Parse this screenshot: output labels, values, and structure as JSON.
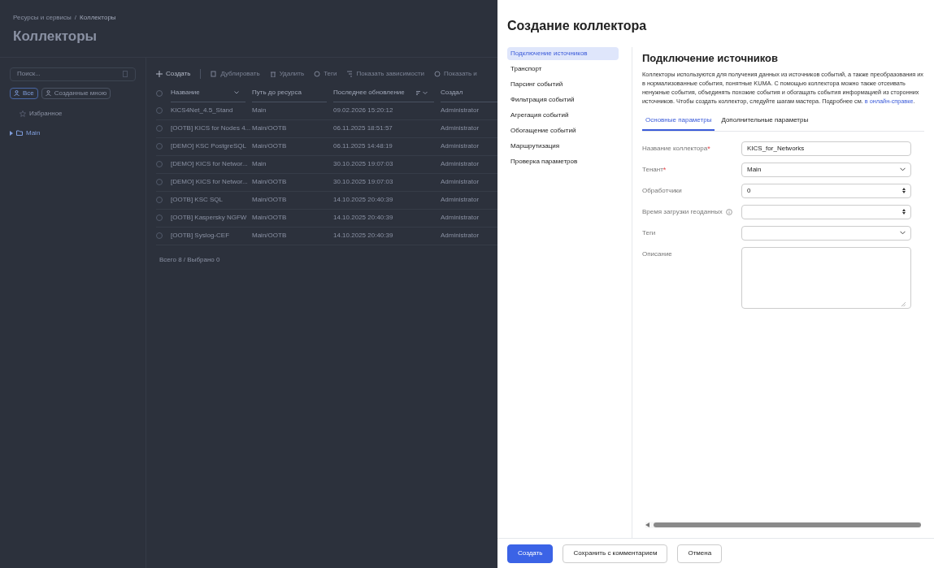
{
  "breadcrumb": {
    "items": [
      "Ресурсы и сервисы",
      "Коллекторы"
    ],
    "separator": "/"
  },
  "page_title": "Коллекторы",
  "sidebar": {
    "search": {
      "placeholder": "Поиск..."
    },
    "filters": [
      {
        "label": "Все",
        "selected": true
      },
      {
        "label": "Созданные мною",
        "selected": false
      }
    ],
    "tree": [
      {
        "label": "Избранное",
        "kind": "favorites"
      },
      {
        "label": "Main",
        "kind": "folder",
        "expanded": false
      }
    ]
  },
  "toolbar": [
    {
      "label": "Создать",
      "kind": "create",
      "disabled": false
    },
    {
      "label": "Дублировать",
      "kind": "duplicate",
      "disabled": true
    },
    {
      "label": "Удалить",
      "kind": "delete",
      "disabled": true
    },
    {
      "label": "Теги",
      "kind": "tags",
      "disabled": true
    },
    {
      "label": "Показать зависимости",
      "kind": "deps",
      "disabled": true
    },
    {
      "label": "Показать и",
      "kind": "history",
      "disabled": true
    }
  ],
  "table": {
    "select_all_checked": false,
    "columns": [
      "Название",
      "Путь до ресурса",
      "Последнее обновление",
      "Создал"
    ],
    "rows": [
      {
        "cells": [
          "KICS4Net_4.5_Stand",
          "Main",
          "09.02.2026 15:20:12",
          "Administrator"
        ],
        "checked": false
      },
      {
        "cells": [
          "[OOTB] KICS for Nodes 4...",
          "Main/OOTB",
          "06.11.2025 18:51:57",
          "Administrator"
        ],
        "checked": false
      },
      {
        "cells": [
          "[DEMO] KSC PostgreSQL",
          "Main/OOTB",
          "06.11.2025 14:48:19",
          "Administrator"
        ],
        "checked": false
      },
      {
        "cells": [
          "[DEMO] KICS for Networ...",
          "Main",
          "30.10.2025 19:07:03",
          "Administrator"
        ],
        "checked": false
      },
      {
        "cells": [
          "[DEMO] KICS for Networ...",
          "Main/OOTB",
          "30.10.2025 19:07:03",
          "Administrator"
        ],
        "checked": false
      },
      {
        "cells": [
          "[OOTB] KSC SQL",
          "Main/OOTB",
          "14.10.2025 20:40:39",
          "Administrator"
        ],
        "checked": false
      },
      {
        "cells": [
          "[OOTB] Kaspersky NGFW",
          "Main/OOTB",
          "14.10.2025 20:40:39",
          "Administrator"
        ],
        "checked": false
      },
      {
        "cells": [
          "[OOTB] Syslog-CEF",
          "Main/OOTB",
          "14.10.2025 20:40:39",
          "Administrator"
        ],
        "checked": false
      }
    ],
    "footer": "Всего 8 / Выбрано 0"
  },
  "drawer": {
    "title": "Создание коллектора",
    "steps": [
      {
        "label": "Подключение источников",
        "selected": true
      },
      {
        "label": "Транспорт",
        "selected": false
      },
      {
        "label": "Парсинг событий",
        "selected": false
      },
      {
        "label": "Фильтрация событий",
        "selected": false
      },
      {
        "label": "Агрегация событий",
        "selected": false
      },
      {
        "label": "Обогащение событий",
        "selected": false
      },
      {
        "label": "Маршрутизация",
        "selected": false
      },
      {
        "label": "Проверка параметров",
        "selected": false
      }
    ],
    "heading": "Подключение источников",
    "description": "Коллекторы используются для получения данных из источников событий, а также преобразования их в нормализованные события, понятные KUMA. С помощью коллектора можно также отсеивать ненужные события, объединять похожие события и обогащать события информацией из сторонних источников. Чтобы создать коллектор, следуйте шагам мастера. Подробнее см.",
    "description_link": "в онлайн-справке",
    "description_end": ".",
    "tabs": [
      {
        "label": "Основные параметры",
        "selected": true
      },
      {
        "label": "Дополнительные параметры",
        "selected": false
      }
    ],
    "fields": [
      {
        "label": "Название коллектора",
        "kind": "text",
        "required_mark": "*",
        "value": "KICS_for_Networks"
      },
      {
        "label": "Тенант",
        "kind": "select",
        "required_mark": "*",
        "value": "Main"
      },
      {
        "label": "Обработчики",
        "kind": "number",
        "value": "0"
      },
      {
        "label": "Время загрузки геоданных",
        "kind": "number",
        "info": true
      },
      {
        "label": "Теги",
        "kind": "select"
      },
      {
        "label": "Описание",
        "kind": "textarea"
      }
    ],
    "buttons": [
      {
        "label": "Создать",
        "kind": "primary"
      },
      {
        "label": "Сохранить с комментарием",
        "kind": "secondary"
      },
      {
        "label": "Отмена",
        "kind": "secondary"
      }
    ]
  }
}
